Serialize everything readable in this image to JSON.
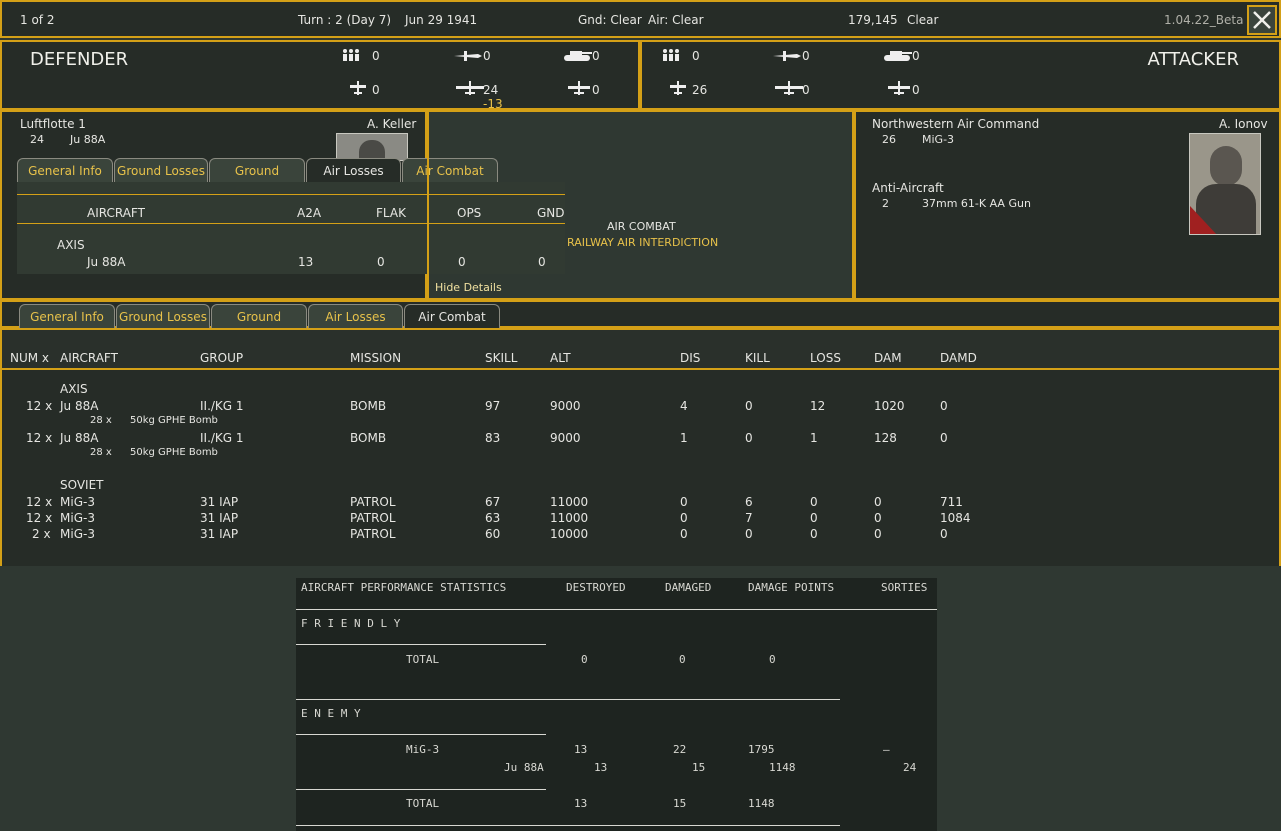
{
  "top": {
    "page": "1 of 2",
    "turn": "Turn : 2 (Day 7)",
    "date": "Jun 29 1941",
    "ground": "Gnd: Clear",
    "air": "Air: Clear",
    "loc": "179,145",
    "weather": "Clear",
    "version": "1.04.22_Beta"
  },
  "defender": {
    "title": "DEFENDER",
    "stats": [
      "0",
      "0",
      "0",
      "0",
      "24",
      "0"
    ],
    "loss": "-13",
    "unit": "Luftflotte 1",
    "commander": "A. Keller",
    "count": "24",
    "type": "Ju 88A"
  },
  "attacker": {
    "title": "ATTACKER",
    "stats": [
      "0",
      "0",
      "0",
      "26",
      "0",
      "0"
    ],
    "unit": "Northwestern Air Command",
    "commander": "A. Ionov",
    "count": "26",
    "type": "MiG-3",
    "aa_title": "Anti-Aircraft",
    "aa_count": "2",
    "aa_type": "37mm 61-K AA Gun"
  },
  "tabs": [
    "General Info",
    "Ground Losses",
    "Ground Combat",
    "Air Losses",
    "Air Combat"
  ],
  "losses": {
    "headers": [
      "AIRCRAFT",
      "A2A",
      "FLAK",
      "OPS",
      "GND"
    ],
    "group": "AXIS",
    "row": [
      "Ju 88A",
      "13",
      "0",
      "0",
      "0"
    ]
  },
  "center": {
    "line1": "AIR COMBAT",
    "line2": "RAILWAY AIR INTERDICTION",
    "hide": "Hide Details"
  },
  "combat": {
    "headers": [
      "NUM x",
      "AIRCRAFT",
      "GROUP",
      "MISSION",
      "SKILL",
      "ALT",
      "DIS",
      "KILL",
      "LOSS",
      "DAM",
      "DAMD"
    ],
    "axis_label": "AXIS",
    "soviet_label": "SOVIET",
    "axis": [
      {
        "num": "12 x",
        "ac": "Ju 88A",
        "group": "II./KG 1",
        "mission": "BOMB",
        "skill": "97",
        "alt": "9000",
        "dis": "4",
        "kill": "0",
        "loss": "12",
        "dam": "1020",
        "damd": "0",
        "bomb_n": "28 x",
        "bomb": "50kg GPHE Bomb"
      },
      {
        "num": "12 x",
        "ac": "Ju 88A",
        "group": "II./KG 1",
        "mission": "BOMB",
        "skill": "83",
        "alt": "9000",
        "dis": "1",
        "kill": "0",
        "loss": "1",
        "dam": "128",
        "damd": "0",
        "bomb_n": "28 x",
        "bomb": "50kg GPHE Bomb"
      }
    ],
    "soviet": [
      {
        "num": "12 x",
        "ac": "MiG-3",
        "group": "31 IAP",
        "mission": "PATROL",
        "skill": "67",
        "alt": "11000",
        "dis": "0",
        "kill": "6",
        "loss": "0",
        "dam": "0",
        "damd": "711"
      },
      {
        "num": "12 x",
        "ac": "MiG-3",
        "group": "31 IAP",
        "mission": "PATROL",
        "skill": "63",
        "alt": "11000",
        "dis": "0",
        "kill": "7",
        "loss": "0",
        "dam": "0",
        "damd": "1084"
      },
      {
        "num": "2 x",
        "ac": "MiG-3",
        "group": "31 IAP",
        "mission": "PATROL",
        "skill": "60",
        "alt": "10000",
        "dis": "0",
        "kill": "0",
        "loss": "0",
        "dam": "0",
        "damd": "0"
      }
    ]
  },
  "stats": {
    "headers": [
      "AIRCRAFT PERFORMANCE STATISTICS",
      "DESTROYED",
      "DAMAGED",
      "DAMAGE POINTS",
      "SORTIES"
    ],
    "friendly": "F R I E N D L Y",
    "enemy": "E N E M Y",
    "total_label": "TOTAL",
    "friendly_total": [
      "0",
      "0",
      "0"
    ],
    "mig": [
      "MiG-3",
      "13",
      "22",
      "1795",
      "–"
    ],
    "ju": [
      "Ju 88A",
      "13",
      "15",
      "1148",
      "24"
    ],
    "enemy_total": [
      "13",
      "15",
      "1148"
    ]
  }
}
